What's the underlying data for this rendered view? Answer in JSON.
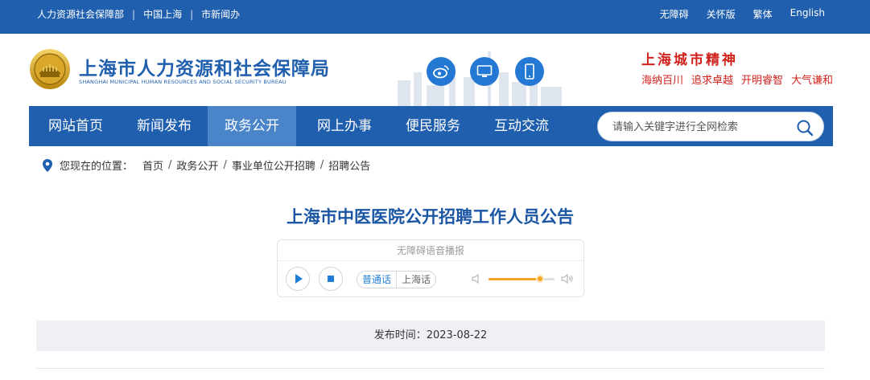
{
  "topbar": {
    "links_left": [
      "人力资源社会保障部",
      "中国上海",
      "市新闻办"
    ],
    "links_right": [
      "无障碍",
      "关怀版",
      "繁体",
      "English"
    ]
  },
  "header": {
    "title_cn": "上海市人力资源和社会保障局",
    "title_en": "SHANGHAI MUNICIPAL HUMAN RESOURCES AND SOCIAL SECURITY BUREAU",
    "spirit_title": "上海城市精神",
    "spirit_values": [
      "海纳百川",
      "追求卓越",
      "开明睿智",
      "大气谦和"
    ],
    "social_icons": [
      "weibo-icon",
      "desktop-icon",
      "mobile-icon"
    ]
  },
  "nav": {
    "items": [
      "网站首页",
      "新闻发布",
      "政务公开",
      "网上办事",
      "便民服务",
      "互动交流"
    ],
    "active": "政务公开"
  },
  "search": {
    "placeholder": "请输入关键字进行全网检索"
  },
  "breadcrumb": {
    "label": "您现在的位置：",
    "items": [
      "首页",
      "政务公开",
      "事业单位公开招聘",
      "招聘公告"
    ]
  },
  "article": {
    "title": "上海市中医医院公开招聘工作人员公告",
    "publish_label": "发布时间：2023-08-22"
  },
  "player": {
    "header": "无障碍语音播报",
    "lang_options": [
      "普通话",
      "上海话"
    ],
    "selected_lang": "普通话",
    "volume": 0.78,
    "accent_color": "#f5a623"
  },
  "colors": {
    "brand": "#1f5fad",
    "nav_active": "#4a84c9",
    "spirit": "#d0221c",
    "title": "#1a56a3"
  }
}
